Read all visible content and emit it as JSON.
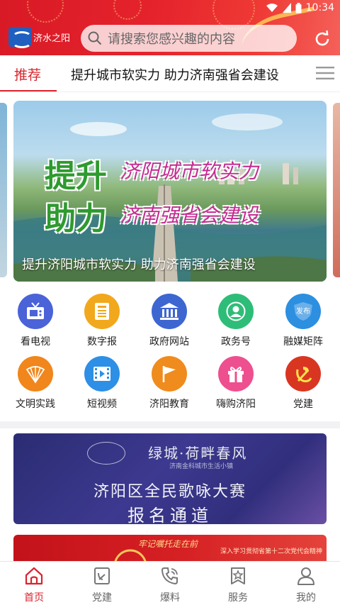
{
  "status": {
    "time": "10:34"
  },
  "header": {
    "logo_text": "济水之阳",
    "search_placeholder": "请搜索您感兴趣的内容"
  },
  "tabs": {
    "active": "推荐",
    "headline": "提升城市软实力 助力济南强省会建设"
  },
  "banner": {
    "caption": "提升济阳城市软实力 助力济南强省会建设",
    "art_word1": "提升",
    "art_word2": "助力",
    "art_line1": "济阳城市软实力",
    "art_line2": "济南强省会建设"
  },
  "grid": {
    "items": [
      {
        "label": "看电视",
        "icon": "tv-icon",
        "color": "#4a63d8"
      },
      {
        "label": "数字报",
        "icon": "newspaper-icon",
        "color": "#f2a81c"
      },
      {
        "label": "政府网站",
        "icon": "government-building-icon",
        "color": "#3d66d1"
      },
      {
        "label": "政务号",
        "icon": "user-account-icon",
        "color": "#2ebd78"
      },
      {
        "label": "融媒矩阵",
        "icon": "release-shield-icon",
        "color": "#2c8fe0"
      },
      {
        "label": "文明实践",
        "icon": "fan-icon",
        "color": "#f0861c"
      },
      {
        "label": "短视频",
        "icon": "video-icon",
        "color": "#2d8fe6"
      },
      {
        "label": "济阳教育",
        "icon": "flag-icon",
        "color": "#f08b1e"
      },
      {
        "label": "嗨购济阳",
        "icon": "gift-icon",
        "color": "#ee4f8f"
      },
      {
        "label": "党建",
        "icon": "party-emblem-icon",
        "color": "#d93622"
      }
    ],
    "badge_text": "发布"
  },
  "ads": {
    "ad1_top": "绿城·荷畔春风",
    "ad1_sub": "济南金科城市生活小镇",
    "ad1_line1": "济阳区全民歌咏大赛",
    "ad1_line2": "报名通道",
    "ad2_text": "深入学习贯彻省第十二次党代会精神",
    "ad2_script": "牢记嘱托走在前"
  },
  "bottom_nav": {
    "items": [
      {
        "label": "首页",
        "icon": "home-icon",
        "active": true
      },
      {
        "label": "党建",
        "icon": "party-book-icon",
        "active": false
      },
      {
        "label": "爆料",
        "icon": "phone-icon",
        "active": false
      },
      {
        "label": "服务",
        "icon": "bookmark-star-icon",
        "active": false
      },
      {
        "label": "我的",
        "icon": "profile-icon",
        "active": false
      }
    ]
  },
  "colors": {
    "brand_red": "#d9252e",
    "nav_inactive": "#666666"
  }
}
